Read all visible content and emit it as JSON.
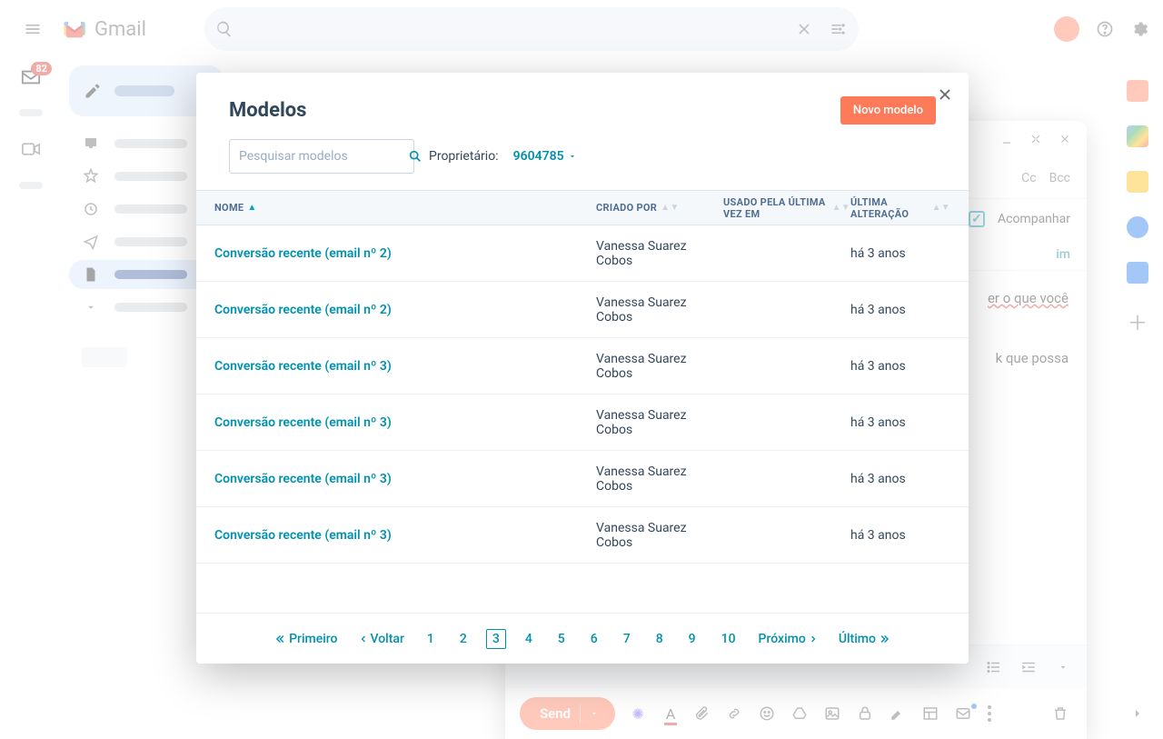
{
  "gmail": {
    "product_name": "Gmail",
    "mail_badge_count": "82",
    "compose": {
      "cc": "Cc",
      "bcc": "Bcc",
      "track_label": "Acompanhar",
      "subject_link": "im",
      "body_fragment_1": "er o que você",
      "body_fragment_2": "k que possa",
      "send_label": "Send"
    }
  },
  "modal": {
    "title": "Modelos",
    "new_button": "Novo modelo",
    "search_placeholder": "Pesquisar modelos",
    "owner_label": "Proprietário:",
    "owner_value": "9604785",
    "columns": {
      "name": "NOME",
      "created_by": "CRIADO POR",
      "last_used": "USADO PELA ÚLTIMA VEZ EM",
      "last_mod": "ÚLTIMA ALTERAÇÃO"
    },
    "rows": [
      {
        "name": "Conversão recente (email nº 2)",
        "created_by": "Vanessa Suarez Cobos",
        "last_used": "",
        "last_mod": "há 3 anos"
      },
      {
        "name": "Conversão recente (email nº 2)",
        "created_by": "Vanessa Suarez Cobos",
        "last_used": "",
        "last_mod": "há 3 anos"
      },
      {
        "name": "Conversão recente (email nº 3)",
        "created_by": "Vanessa Suarez Cobos",
        "last_used": "",
        "last_mod": "há 3 anos"
      },
      {
        "name": "Conversão recente (email nº 3)",
        "created_by": "Vanessa Suarez Cobos",
        "last_used": "",
        "last_mod": "há 3 anos"
      },
      {
        "name": "Conversão recente (email nº 3)",
        "created_by": "Vanessa Suarez Cobos",
        "last_used": "",
        "last_mod": "há 3 anos"
      },
      {
        "name": "Conversão recente (email nº 3)",
        "created_by": "Vanessa Suarez Cobos",
        "last_used": "",
        "last_mod": "há 3 anos"
      }
    ],
    "pagination": {
      "first": "Primeiro",
      "prev": "Voltar",
      "pages": [
        "1",
        "2",
        "3",
        "4",
        "5",
        "6",
        "7",
        "8",
        "9",
        "10"
      ],
      "active": "3",
      "next": "Próximo",
      "last": "Último"
    }
  }
}
